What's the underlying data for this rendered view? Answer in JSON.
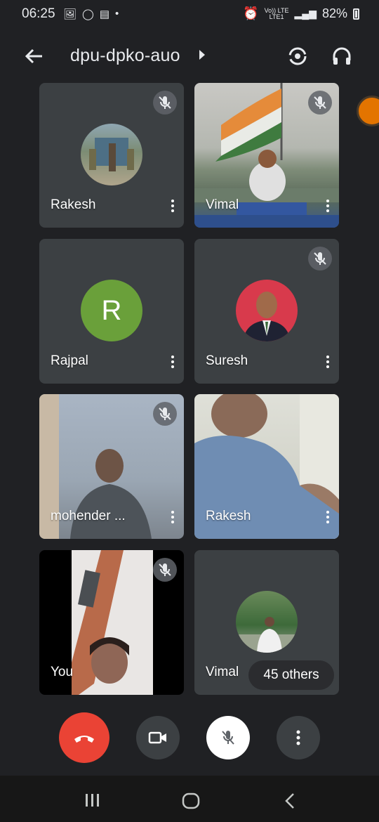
{
  "status": {
    "time": "06:25",
    "network_top": "Vo)) LTE",
    "network_bottom": "LTE1",
    "battery": "82%"
  },
  "header": {
    "meeting_code": "dpu-dpko-auo"
  },
  "participants": [
    {
      "name": "Rakesh",
      "muted": true
    },
    {
      "name": "Vimal",
      "muted": true
    },
    {
      "name": "Rajpal",
      "avatar_letter": "R",
      "muted": false
    },
    {
      "name": "Suresh",
      "muted": true
    },
    {
      "name": "mohender ...",
      "muted": true
    },
    {
      "name": "Rakesh",
      "muted": false
    },
    {
      "name": "You",
      "muted": true
    },
    {
      "name": "Vimal",
      "muted": false
    }
  ],
  "others_count_label": "45 others",
  "colors": {
    "background": "#202124",
    "tile": "#3c4043",
    "end_call": "#ea4335",
    "avatar_green": "#6aa03a"
  }
}
